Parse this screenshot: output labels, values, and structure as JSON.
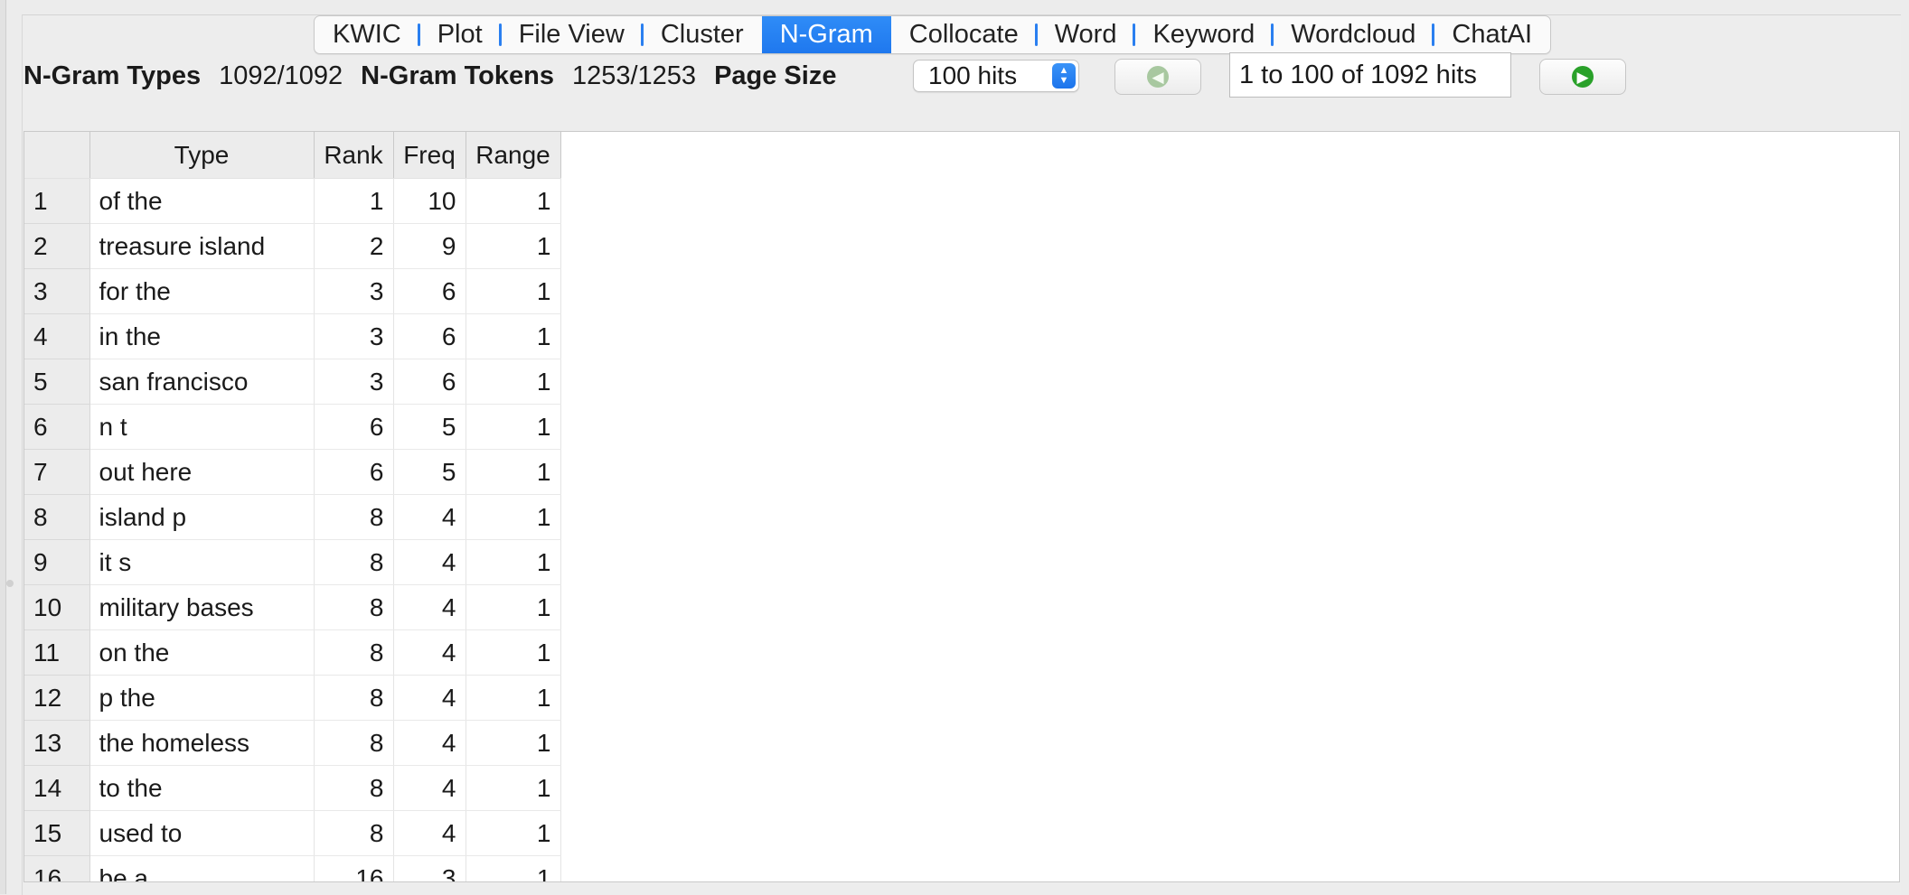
{
  "tabs": [
    {
      "label": "KWIC",
      "active": false
    },
    {
      "label": "Plot",
      "active": false
    },
    {
      "label": "File View",
      "active": false
    },
    {
      "label": "Cluster",
      "active": false
    },
    {
      "label": "N-Gram",
      "active": true
    },
    {
      "label": "Collocate",
      "active": false
    },
    {
      "label": "Word",
      "active": false
    },
    {
      "label": "Keyword",
      "active": false
    },
    {
      "label": "Wordcloud",
      "active": false
    },
    {
      "label": "ChatAI",
      "active": false
    }
  ],
  "toolbar": {
    "types_label": "N-Gram Types",
    "types_value": "1092/1092",
    "tokens_label": "N-Gram Tokens",
    "tokens_value": "1253/1253",
    "page_size_label": "Page Size",
    "page_size_value": "100 hits",
    "page_range": "1 to 100 of 1092 hits"
  },
  "table": {
    "headers": [
      "",
      "Type",
      "Rank",
      "Freq",
      "Range"
    ],
    "rows": [
      {
        "n": "1",
        "type": "of the",
        "rank": "1",
        "freq": "10",
        "range": "1"
      },
      {
        "n": "2",
        "type": "treasure island",
        "rank": "2",
        "freq": "9",
        "range": "1"
      },
      {
        "n": "3",
        "type": "for the",
        "rank": "3",
        "freq": "6",
        "range": "1"
      },
      {
        "n": "4",
        "type": "in the",
        "rank": "3",
        "freq": "6",
        "range": "1"
      },
      {
        "n": "5",
        "type": "san francisco",
        "rank": "3",
        "freq": "6",
        "range": "1"
      },
      {
        "n": "6",
        "type": "n t",
        "rank": "6",
        "freq": "5",
        "range": "1"
      },
      {
        "n": "7",
        "type": "out here",
        "rank": "6",
        "freq": "5",
        "range": "1"
      },
      {
        "n": "8",
        "type": "island p",
        "rank": "8",
        "freq": "4",
        "range": "1"
      },
      {
        "n": "9",
        "type": "it s",
        "rank": "8",
        "freq": "4",
        "range": "1"
      },
      {
        "n": "10",
        "type": "military bases",
        "rank": "8",
        "freq": "4",
        "range": "1"
      },
      {
        "n": "11",
        "type": "on the",
        "rank": "8",
        "freq": "4",
        "range": "1"
      },
      {
        "n": "12",
        "type": "p the",
        "rank": "8",
        "freq": "4",
        "range": "1"
      },
      {
        "n": "13",
        "type": "the homeless",
        "rank": "8",
        "freq": "4",
        "range": "1"
      },
      {
        "n": "14",
        "type": "to the",
        "rank": "8",
        "freq": "4",
        "range": "1"
      },
      {
        "n": "15",
        "type": "used to",
        "rank": "8",
        "freq": "4",
        "range": "1"
      },
      {
        "n": "16",
        "type": "be a",
        "rank": "16",
        "freq": "3",
        "range": "1"
      }
    ]
  },
  "colors": {
    "accent": "#1f78ee",
    "next_green": "#2aa12a"
  }
}
